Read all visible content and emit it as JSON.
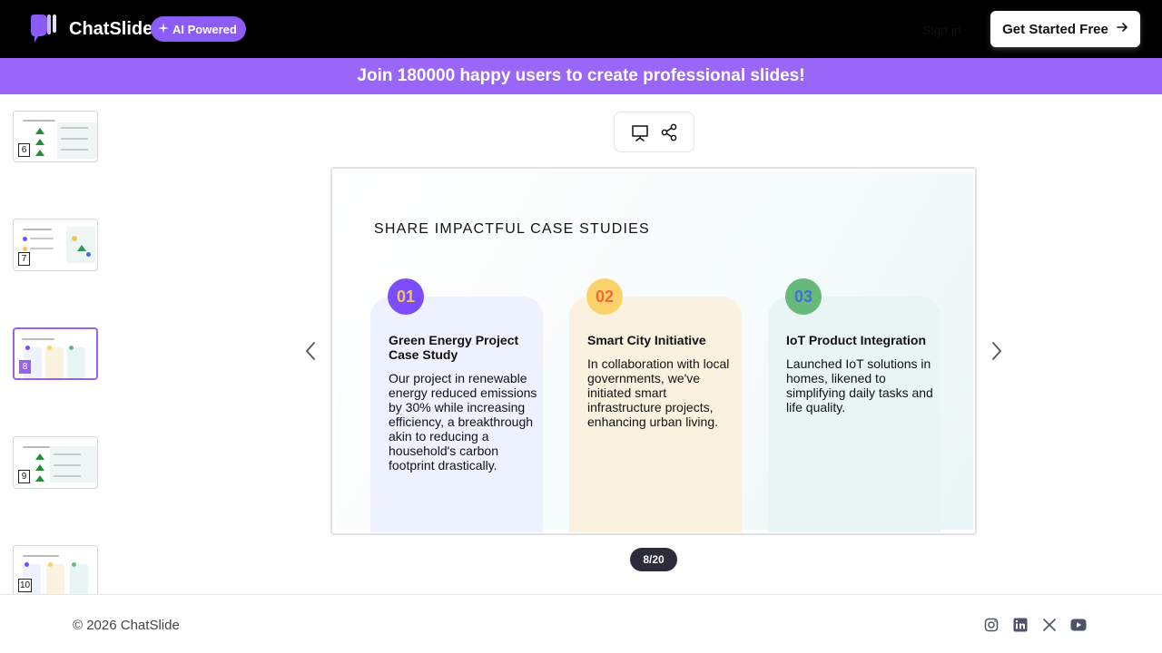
{
  "header": {
    "brand": "ChatSlide",
    "badge": "AI Powered",
    "sign_in": "Sign in",
    "cta": "Get Started Free"
  },
  "banner": {
    "text": "Join 180000 happy users to create professional slides!"
  },
  "thumbnails": [
    {
      "number": "6",
      "active": false
    },
    {
      "number": "7",
      "active": false
    },
    {
      "number": "8",
      "active": true
    },
    {
      "number": "9",
      "active": false
    },
    {
      "number": "10",
      "active": false
    }
  ],
  "toolbar": {
    "present_icon": "presentation-icon",
    "share_icon": "share-icon"
  },
  "slide": {
    "title": "SHARE IMPACTFUL CASE STUDIES",
    "cards": [
      {
        "number": "01",
        "title": "Green Energy Project Case Study",
        "body": "Our project in renewable energy reduced emissions by 30% while increasing efficiency, a breakthrough akin to reducing a household's carbon footprint drastically.",
        "circle_color": "#7c4dff",
        "number_color": "#f5c453",
        "card_color": "#eef1ff"
      },
      {
        "number": "02",
        "title": "Smart City Initiative",
        "body": "In collaboration with local governments, we've initiated smart infrastructure projects, enhancing urban living.",
        "circle_color": "#fbd26a",
        "number_color": "#f06a3c",
        "card_color": "#fbf1df"
      },
      {
        "number": "03",
        "title": "IoT Product Integration",
        "body": "Launched IoT solutions in homes, likened to simplifying daily tasks and life quality.",
        "circle_color": "#66b97a",
        "number_color": "#3f6ee0",
        "card_color": "#e9f5f4"
      }
    ]
  },
  "pager": {
    "text": "8/20"
  },
  "footer": {
    "copyright": "© 2026 ChatSlide",
    "social_icons": [
      "instagram-icon",
      "linkedin-icon",
      "x-icon",
      "youtube-icon"
    ]
  },
  "colors": {
    "accent": "#9966f7",
    "topbar": "#000000"
  }
}
